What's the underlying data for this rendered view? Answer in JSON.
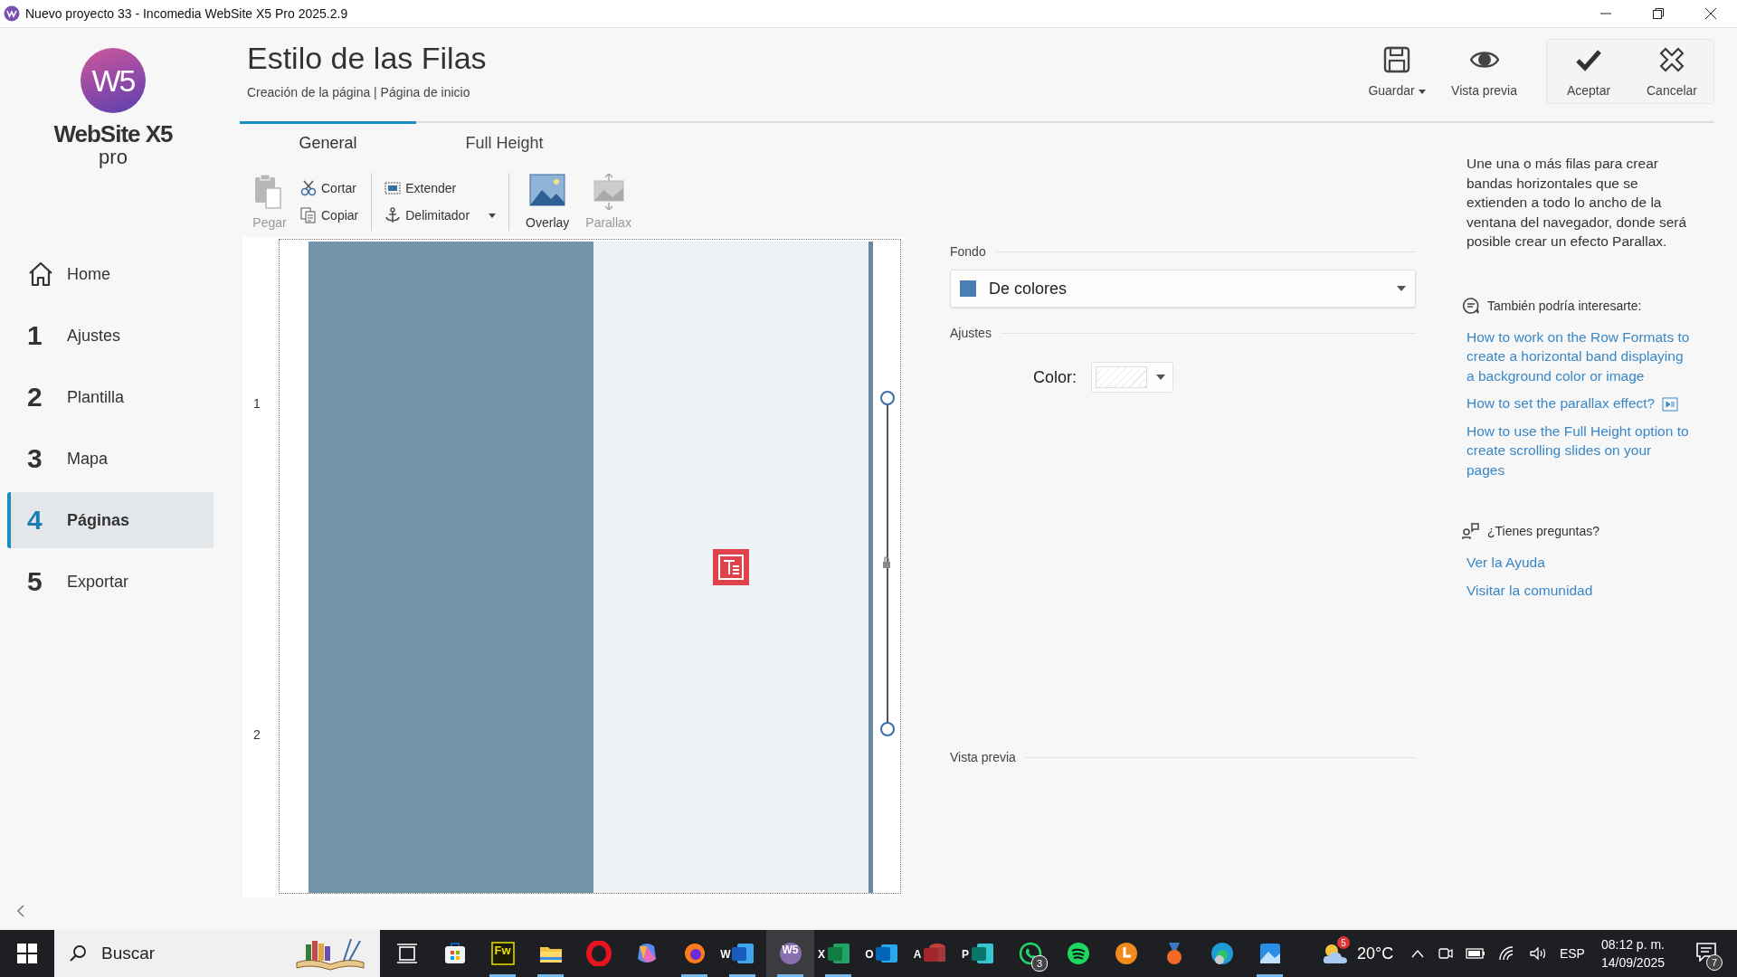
{
  "window": {
    "title": "Nuevo proyecto 33 - Incomedia WebSite X5 Pro 2025.2.9"
  },
  "logo": {
    "mark": "W5",
    "name": "WebSite X5",
    "edition": "pro"
  },
  "sidebar": {
    "items": [
      {
        "kind": "home",
        "label": "Home",
        "selected": false
      },
      {
        "kind": "step",
        "number": "1",
        "label": "Ajustes",
        "selected": false
      },
      {
        "kind": "step",
        "number": "2",
        "label": "Plantilla",
        "selected": false
      },
      {
        "kind": "step",
        "number": "3",
        "label": "Mapa",
        "selected": false
      },
      {
        "kind": "step",
        "number": "4",
        "label": "Páginas",
        "selected": true
      },
      {
        "kind": "step",
        "number": "5",
        "label": "Exportar",
        "selected": false
      }
    ]
  },
  "header": {
    "title": "Estilo de las Filas",
    "breadcrumb": "Creación de la página | Página de inicio"
  },
  "actions": [
    {
      "kind": "save",
      "label": "Guardar",
      "menu": true
    },
    {
      "kind": "preview",
      "label": "Vista previa",
      "menu": false
    }
  ],
  "confirm_actions": [
    {
      "kind": "accept",
      "label": "Aceptar"
    },
    {
      "kind": "cancel",
      "label": "Cancelar"
    }
  ],
  "tabs": [
    {
      "label": "General",
      "selected": true
    },
    {
      "label": "Full Height",
      "selected": false
    }
  ],
  "toolbar": {
    "groups": [
      {
        "large": [
          {
            "kind": "paste",
            "label": "Pegar",
            "disabled": true
          }
        ],
        "small": [
          {
            "kind": "cut",
            "label": "Cortar",
            "disabled": false
          },
          {
            "kind": "copy",
            "label": "Copiar",
            "disabled": false
          }
        ]
      },
      {
        "small": [
          {
            "kind": "extend",
            "label": "Extender",
            "disabled": false
          },
          {
            "kind": "anchor",
            "label": "Delimitador",
            "disabled": false,
            "menu": true
          }
        ]
      },
      {
        "large": [
          {
            "kind": "overlay",
            "label": "Overlay",
            "disabled": false
          },
          {
            "kind": "parallax",
            "label": "Parallax",
            "disabled": true
          }
        ]
      }
    ]
  },
  "row_editor": {
    "row_numbers": [
      "1",
      "2"
    ],
    "columns": [
      {
        "color": "#7393aa"
      },
      {
        "color": "#edf2f6",
        "objects": [
          {
            "kind": "text"
          }
        ]
      }
    ]
  },
  "properties": {
    "background": {
      "label": "Fondo",
      "value": "De colores",
      "color": "#4a7fb5"
    },
    "settings": {
      "label": "Ajustes",
      "field_label": "Color:",
      "transparent": true
    },
    "preview": {
      "label": "Vista previa"
    }
  },
  "help": {
    "description": "Une una o más filas para crear bandas horizontales que se extienden a todo lo ancho de la ventana del navegador, donde será posible crear un efecto Parallax.",
    "related": {
      "title": "También podría interesarte:",
      "links": [
        {
          "label": "How to work on the Row Formats to create a horizontal band displaying a background color or image",
          "video": false
        },
        {
          "label": "How to set the parallax effect?",
          "video": true
        },
        {
          "label": "How to use the Full Height option to create scrolling slides on your pages",
          "video": false
        }
      ]
    },
    "questions": {
      "title": "¿Tienes preguntas?",
      "links": [
        {
          "label": "Ver la Ayuda"
        },
        {
          "label": "Visitar la comunidad"
        }
      ]
    }
  },
  "taskbar": {
    "search_placeholder": "Buscar",
    "apps": [
      {
        "kind": "taskview",
        "running": false,
        "selected": false
      },
      {
        "kind": "store",
        "running": false,
        "selected": false
      },
      {
        "kind": "fireworks",
        "glyph": "Fw",
        "running": true,
        "selected": false
      },
      {
        "kind": "folder",
        "running": true,
        "selected": false
      },
      {
        "kind": "opera",
        "running": false,
        "selected": false
      },
      {
        "kind": "copilot",
        "running": false,
        "selected": false
      },
      {
        "kind": "firefox",
        "running": true,
        "selected": false
      },
      {
        "kind": "word",
        "glyph": "W",
        "running": true,
        "selected": false
      },
      {
        "kind": "website",
        "glyph": "W5",
        "running": true,
        "selected": true
      },
      {
        "kind": "excel",
        "glyph": "X",
        "running": true,
        "selected": false
      },
      {
        "kind": "outlook",
        "glyph": "O",
        "running": false,
        "selected": false
      },
      {
        "kind": "access",
        "glyph": "A",
        "running": false,
        "selected": false
      },
      {
        "kind": "publisher",
        "glyph": "P",
        "running": false,
        "selected": false
      },
      {
        "kind": "whatsapp",
        "badge": "3",
        "running": false,
        "selected": false
      },
      {
        "kind": "spotify",
        "running": false,
        "selected": false
      },
      {
        "kind": "orange",
        "running": false,
        "selected": false
      },
      {
        "kind": "medal",
        "running": false,
        "selected": false
      },
      {
        "kind": "edge",
        "running": false,
        "selected": false
      },
      {
        "kind": "photos",
        "running": true,
        "selected": false
      }
    ],
    "weather": {
      "temperature": "20°C",
      "badge": "5"
    },
    "language": "ESP",
    "time": "08:12 p. m.",
    "date": "14/09/2025",
    "notifications": "7"
  }
}
